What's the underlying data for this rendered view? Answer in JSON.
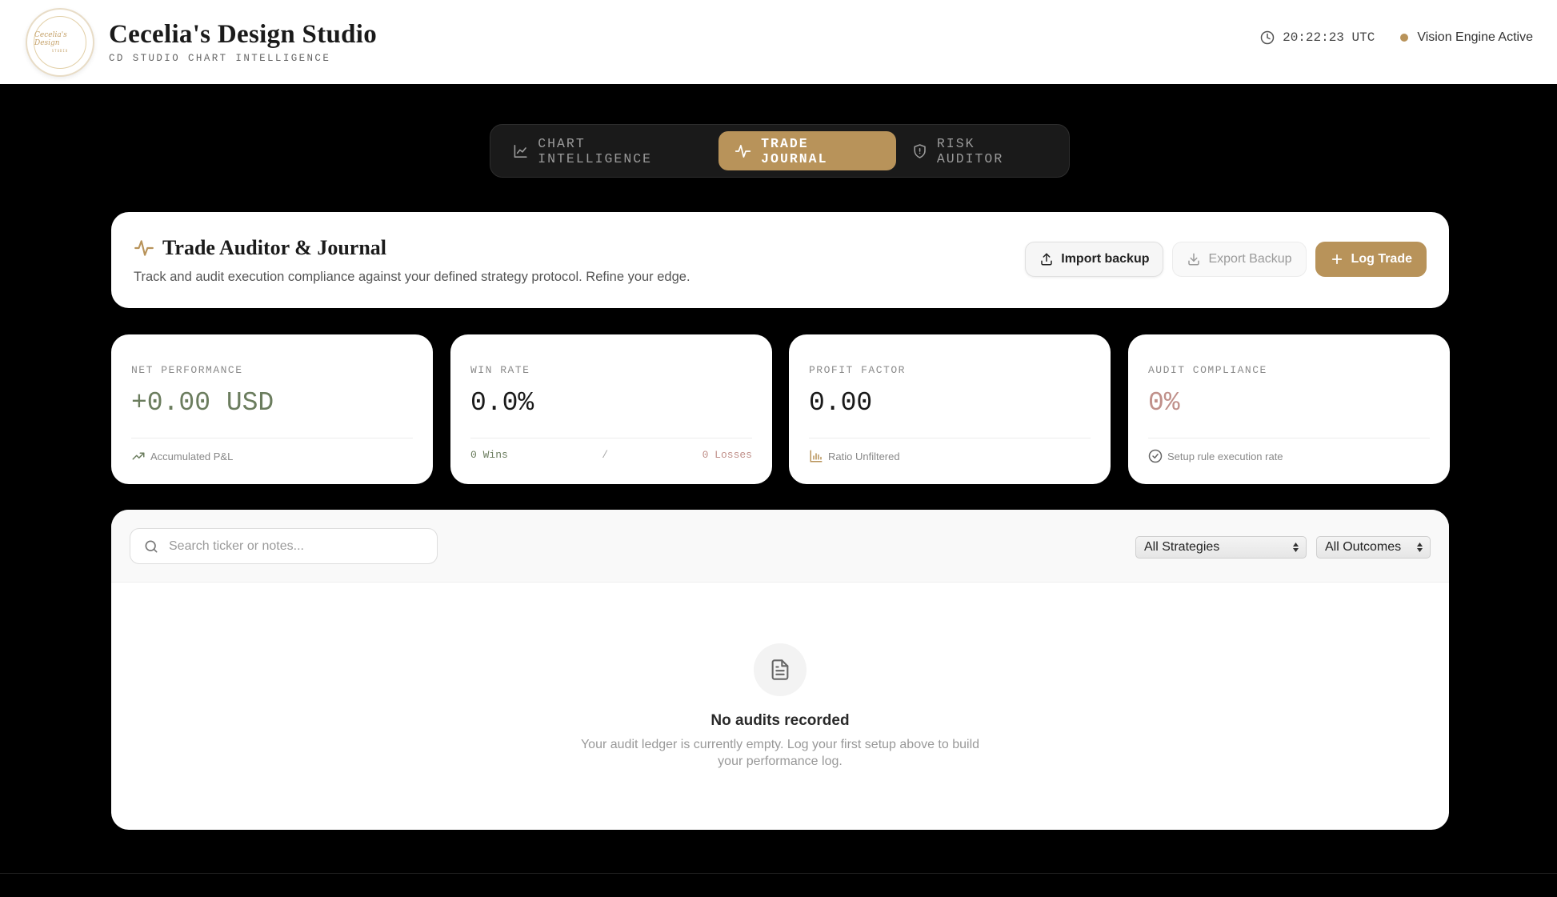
{
  "header": {
    "logo_text": "Cecelia's Design",
    "logo_sub": "STUDIO",
    "title": "Cecelia's Design Studio",
    "subtitle": "CD STUDIO CHART INTELLIGENCE",
    "clock": "20:22:23 UTC",
    "status": "Vision Engine Active",
    "status_color": "#b8935a"
  },
  "tabs": [
    {
      "label": "CHART INTELLIGENCE",
      "icon": "line-chart-icon",
      "active": false
    },
    {
      "label": "TRADE JOURNAL",
      "icon": "activity-icon",
      "active": true
    },
    {
      "label": "RISK AUDITOR",
      "icon": "shield-icon",
      "active": false
    }
  ],
  "journal": {
    "title": "Trade Auditor & Journal",
    "description": "Track and audit execution compliance against your defined strategy protocol. Refine your edge.",
    "import_label": "Import backup",
    "export_label": "Export Backup",
    "log_label": "Log Trade"
  },
  "stats": {
    "net": {
      "label": "NET PERFORMANCE",
      "value": "+0.00 USD",
      "foot": "Accumulated P&L",
      "color": "#6b7d5e"
    },
    "win": {
      "label": "WIN RATE",
      "value": "0.0%",
      "wins": "0 Wins",
      "sep": "/",
      "losses": "0 Losses"
    },
    "profit": {
      "label": "PROFIT FACTOR",
      "value": "0.00",
      "foot": "Ratio Unfiltered"
    },
    "audit": {
      "label": "AUDIT COMPLIANCE",
      "value": "0%",
      "foot": "Setup rule execution rate",
      "color": "#c0908a"
    }
  },
  "filters": {
    "search_placeholder": "Search ticker or notes...",
    "strategy": "All Strategies",
    "outcome": "All Outcomes"
  },
  "empty": {
    "title": "No audits recorded",
    "description": "Your audit ledger is currently empty. Log your first setup above to build your performance log."
  },
  "colors": {
    "accent": "#b8935a",
    "win_green": "#6b7d5e",
    "loss_red": "#c0908a"
  }
}
